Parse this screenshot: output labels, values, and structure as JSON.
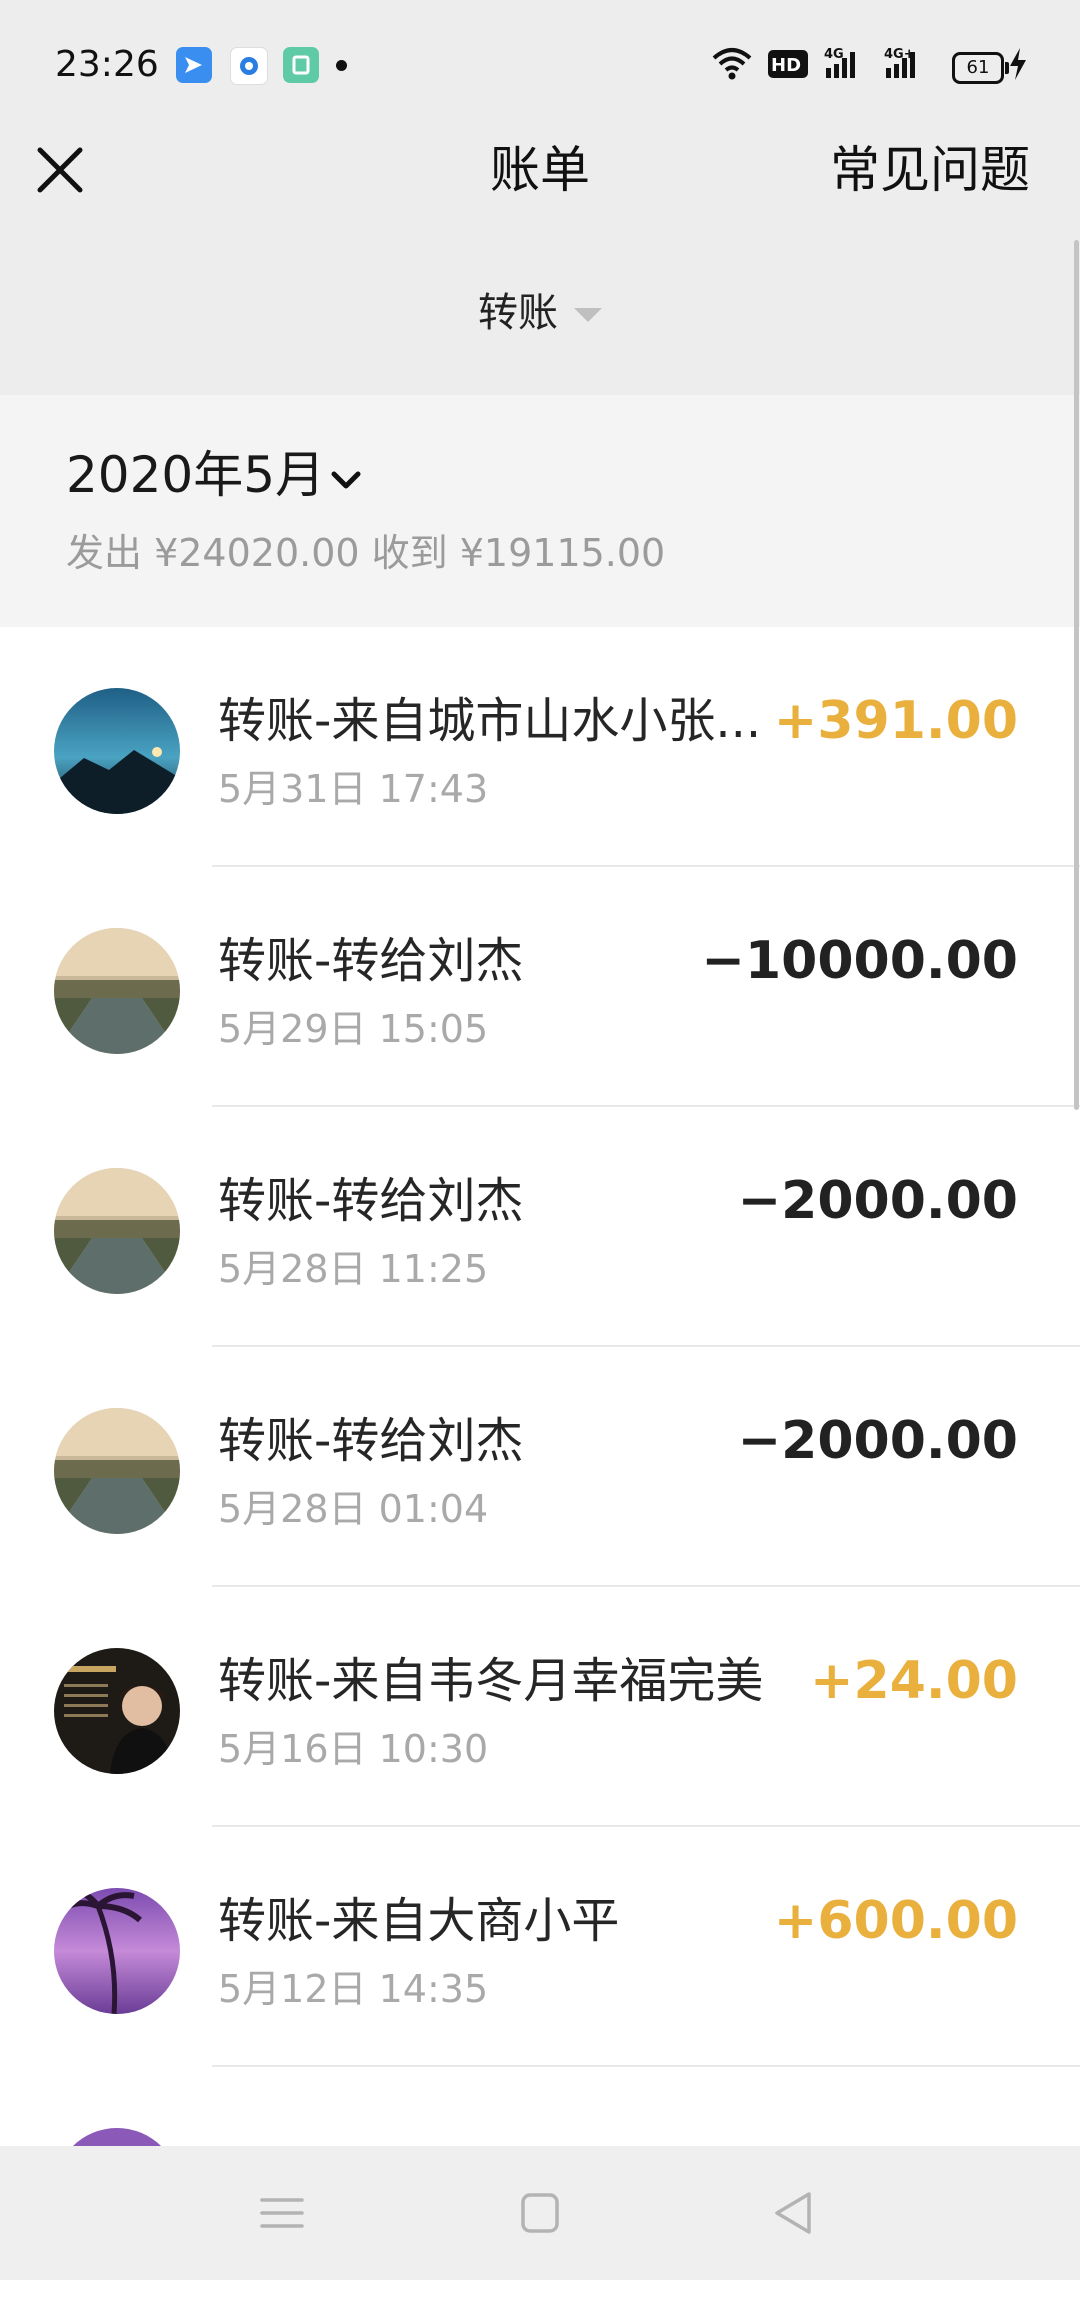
{
  "status_bar": {
    "time": "23:26",
    "battery": "61",
    "icons": [
      "wifi-icon",
      "hd-icon",
      "signal-4g-icon",
      "signal-4g-plus-icon",
      "battery-icon",
      "charging-icon"
    ]
  },
  "header": {
    "title": "账单",
    "faq": "常见问题",
    "close_icon": "close-icon"
  },
  "filter": {
    "label": "转账"
  },
  "month": {
    "title": "2020年5月",
    "summary": "发出 ¥24020.00 收到 ¥19115.00"
  },
  "transactions": [
    {
      "title": "转账-来自城市山水小张...",
      "date": "5月31日 17:43",
      "amount": "+391.00",
      "type": "income"
    },
    {
      "title": "转账-转给刘杰",
      "date": "5月29日 15:05",
      "amount": "−10000.00",
      "type": "expense"
    },
    {
      "title": "转账-转给刘杰",
      "date": "5月28日 11:25",
      "amount": "−2000.00",
      "type": "expense"
    },
    {
      "title": "转账-转给刘杰",
      "date": "5月28日 01:04",
      "amount": "−2000.00",
      "type": "expense"
    },
    {
      "title": "转账-来自韦冬月幸福完美",
      "date": "5月16日 10:30",
      "amount": "+24.00",
      "type": "income"
    },
    {
      "title": "转账-来自大商小平",
      "date": "5月12日 14:35",
      "amount": "+600.00",
      "type": "income"
    }
  ],
  "colors": {
    "income": "#e9b03e",
    "expense": "#222222",
    "header_bg": "#ededed",
    "summary_text": "#9b9b9b"
  }
}
